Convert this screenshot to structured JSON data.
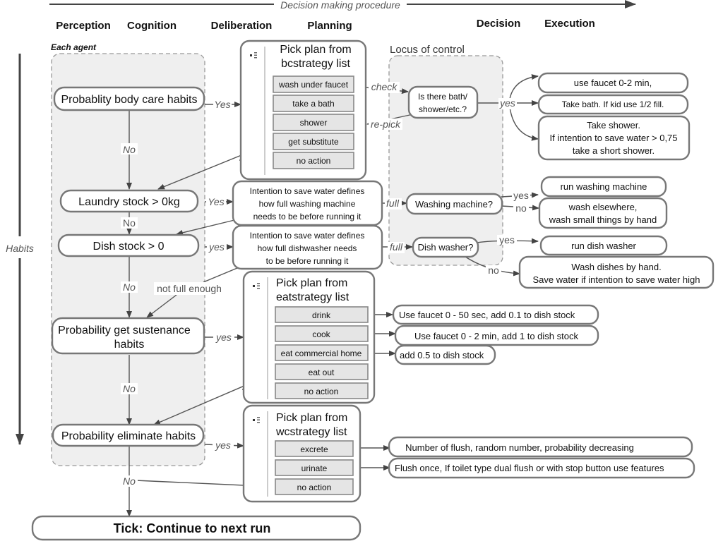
{
  "header": {
    "procedure_label": "Decision making procedure",
    "columns": [
      "Perception",
      "Cognition",
      "Deliberation",
      "Planning",
      "Decision",
      "Execution"
    ],
    "habits_label": "Habits",
    "each_agent_label": "Each agent",
    "locus_label": "Locus of control"
  },
  "perception": {
    "body_care": "Probablity body care habits",
    "laundry": "Laundry stock > 0kg",
    "dish": "Dish stock > 0",
    "sustenance_line1": "Probability get sustenance",
    "sustenance_line2": "habits",
    "eliminate": "Probability eliminate habits"
  },
  "edge_labels": {
    "yes_cap": "Yes",
    "yes": "yes",
    "no_cap": "No",
    "no": "no",
    "check": "check",
    "repick": "re-pick",
    "full": "full",
    "not_full_enough": "not full enough"
  },
  "plans": {
    "bc": {
      "title_line1": "Pick plan from",
      "title_line2": "bcstrategy list",
      "items": [
        "wash under faucet",
        "take a bath",
        "shower",
        "get substitute",
        "no action"
      ]
    },
    "eat": {
      "title_line1": "Pick plan from",
      "title_line2": "eatstrategy list",
      "items": [
        "drink",
        "cook",
        "eat commercial home",
        "eat out",
        "no action"
      ]
    },
    "wc": {
      "title_line1": "Pick plan from",
      "title_line2": "wcstrategy list",
      "items": [
        "excrete",
        "urinate",
        "no action"
      ]
    }
  },
  "deliberation": {
    "washing": [
      "Intention to save water defines",
      "how full washing machine",
      "needs to be before running it"
    ],
    "dishwasher": [
      "Intention to save water defines",
      "how full dishwasher needs",
      "to be before running it"
    ]
  },
  "decision": {
    "bath_q": [
      "Is there bath/",
      "shower/etc.?"
    ],
    "washing_q": "Washing machine?",
    "dish_q": "Dish washer?"
  },
  "execution": {
    "faucet": "use faucet 0-2 min,",
    "bath": "Take bath. If kid use 1/2 fill.",
    "shower": [
      "Take shower.",
      "If intention to save water > 0,75",
      "take a short shower."
    ],
    "run_wm": "run washing machine",
    "wash_else": [
      "wash elsewhere,",
      "wash small things by hand"
    ],
    "run_dw": "run dish washer",
    "hand_dishes": [
      "Wash dishes by hand.",
      "Save water if intention to save water high"
    ],
    "drink": "Use faucet 0 - 50 sec, add 0.1 to dish stock",
    "cook": "Use faucet 0 - 2 min, add 1 to dish stock",
    "commercial": "add 0.5 to dish stock",
    "excrete": "Number of flush, random number, probability decreasing",
    "urinate": "Flush once, If toilet type dual flush or with stop button use features"
  },
  "footer": {
    "tick": "Tick: Continue to next run"
  }
}
